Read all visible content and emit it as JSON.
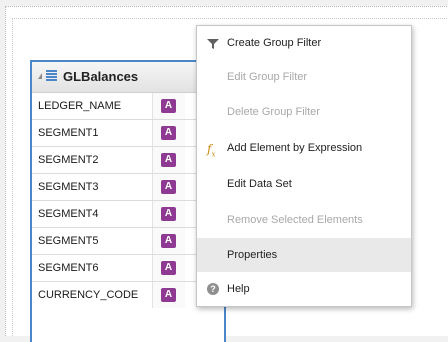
{
  "dataset": {
    "title": "GLBalances",
    "type_badge": "A",
    "rows": [
      {
        "name": "LEDGER_NAME"
      },
      {
        "name": "SEGMENT1"
      },
      {
        "name": "SEGMENT2"
      },
      {
        "name": "SEGMENT3"
      },
      {
        "name": "SEGMENT4"
      },
      {
        "name": "SEGMENT5"
      },
      {
        "name": "SEGMENT6"
      },
      {
        "name": "CURRENCY_CODE"
      }
    ]
  },
  "context_menu": {
    "items": [
      {
        "label": "Create Group Filter",
        "icon": "filter-icon",
        "enabled": true
      },
      {
        "label": "Edit Group Filter",
        "icon": null,
        "enabled": false
      },
      {
        "label": "Delete Group Filter",
        "icon": null,
        "enabled": false
      },
      {
        "label": "Add Element by Expression",
        "icon": "fx-icon",
        "enabled": true
      },
      {
        "label": "Edit Data Set",
        "icon": null,
        "enabled": true
      },
      {
        "label": "Remove Selected Elements",
        "icon": null,
        "enabled": false
      },
      {
        "label": "Properties",
        "icon": null,
        "enabled": true,
        "highlighted": true
      },
      {
        "label": "Help",
        "icon": "help-icon",
        "enabled": true
      }
    ]
  },
  "colors": {
    "selection_border": "#4a86c8",
    "type_badge": "#8e3a93",
    "expression_icon": "#c98a13"
  }
}
